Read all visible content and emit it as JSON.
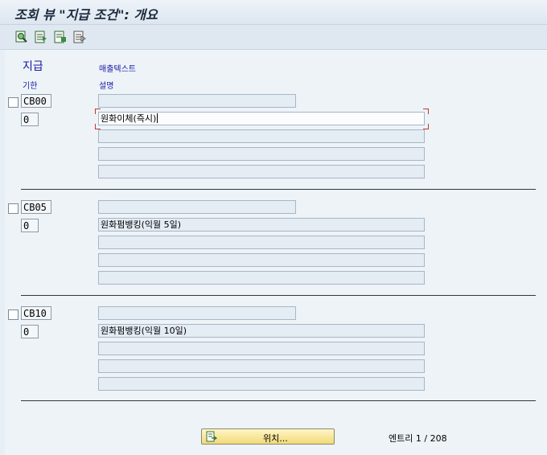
{
  "window": {
    "title": "조회 뷰 \"지급 조건\": 개요"
  },
  "toolbar": {
    "buttons": [
      {
        "icon": "display-find-icon"
      },
      {
        "icon": "select-all-icon"
      },
      {
        "icon": "select-block-icon"
      },
      {
        "icon": "deselect-all-icon"
      }
    ]
  },
  "table": {
    "headers": {
      "col1_line1": "지급",
      "col1_line2": "기한",
      "col2_line1": "매출텍스트",
      "col2_line2": "설명"
    },
    "rows": [
      {
        "code": "CB00",
        "days": "0",
        "sales_text": "",
        "descriptions": [
          "원화이체(즉시)",
          "",
          "",
          ""
        ]
      },
      {
        "code": "CB05",
        "days": "0",
        "sales_text": "",
        "descriptions": [
          "원화펌뱅킹(익월 5일)",
          "",
          "",
          ""
        ]
      },
      {
        "code": "CB10",
        "days": "0",
        "sales_text": "",
        "descriptions": [
          "원화펌뱅킹(익월 10일)",
          "",
          "",
          ""
        ]
      }
    ]
  },
  "footer": {
    "position_button": "위치...",
    "entry_label": "엔트리",
    "entry_value": "1 / 208"
  },
  "colors": {
    "header_text": "#1a1aa6",
    "field_bg": "#e4ecf4",
    "button_bg": "#f2d978"
  }
}
